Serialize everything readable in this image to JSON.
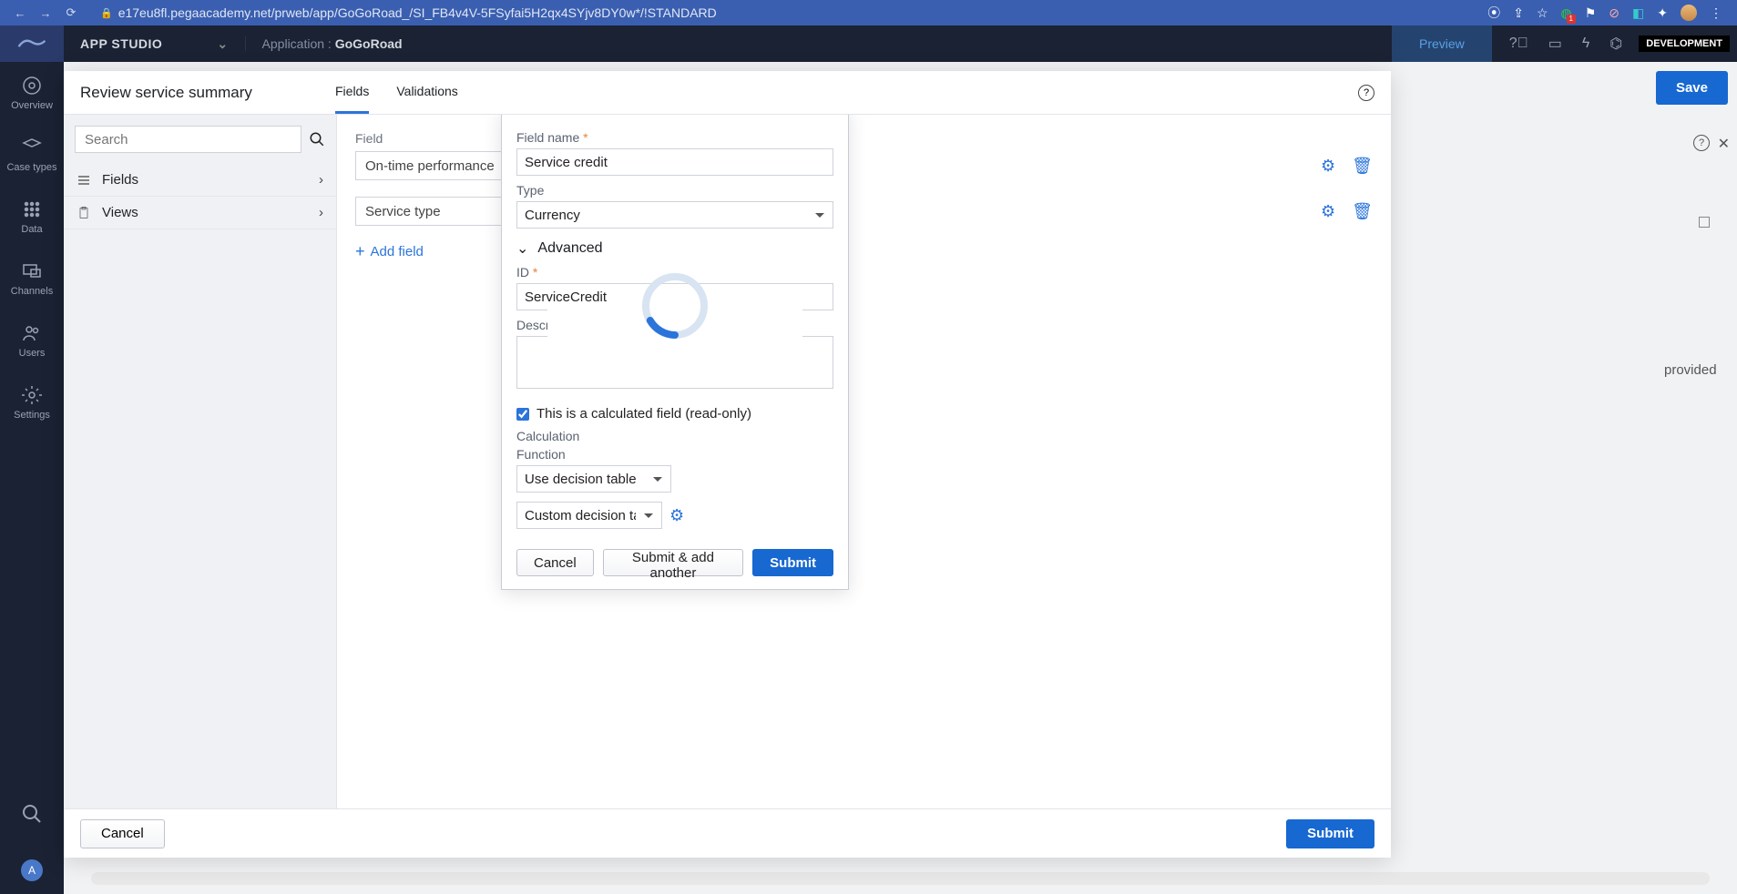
{
  "browser": {
    "url": "e17eu8fl.pegaacademy.net/prweb/app/GoGoRoad_/SI_FB4v4V-5FSyfai5H2qx4SYjv8DY0w*/!STANDARD"
  },
  "header": {
    "studio": "APP STUDIO",
    "app_label": "Application :",
    "app_name": "GoGoRoad",
    "preview": "Preview",
    "env": "DEVELOPMENT",
    "save": "Save"
  },
  "rail": {
    "items": [
      {
        "label": "Overview"
      },
      {
        "label": "Case types"
      },
      {
        "label": "Data"
      },
      {
        "label": "Channels"
      },
      {
        "label": "Users"
      },
      {
        "label": "Settings"
      }
    ],
    "avatar": "A"
  },
  "modal": {
    "title": "Review service summary",
    "tabs": {
      "fields": "Fields",
      "validations": "Validations"
    },
    "search_placeholder": "Search",
    "left_nav": {
      "fields": "Fields",
      "views": "Views"
    },
    "field_label": "Field",
    "rows": [
      {
        "value": "On-time performance"
      },
      {
        "value": "Service type"
      }
    ],
    "add_field": "Add field",
    "footer": {
      "cancel": "Cancel",
      "submit": "Submit"
    }
  },
  "popover": {
    "field_name_label": "Field name",
    "field_name": "Service credit",
    "type_label": "Type",
    "type": "Currency",
    "advanced": "Advanced",
    "id_label": "ID",
    "id": "ServiceCredit",
    "desc_label": "Description",
    "calc_check": "This is a calculated field (read-only)",
    "calculation_label": "Calculation",
    "function_label": "Function",
    "function": "Use decision table",
    "decision_table": "Custom decision tabl",
    "buttons": {
      "cancel": "Cancel",
      "submit_another": "Submit & add another",
      "submit": "Submit"
    }
  },
  "backdrop": {
    "provided": "provided"
  }
}
